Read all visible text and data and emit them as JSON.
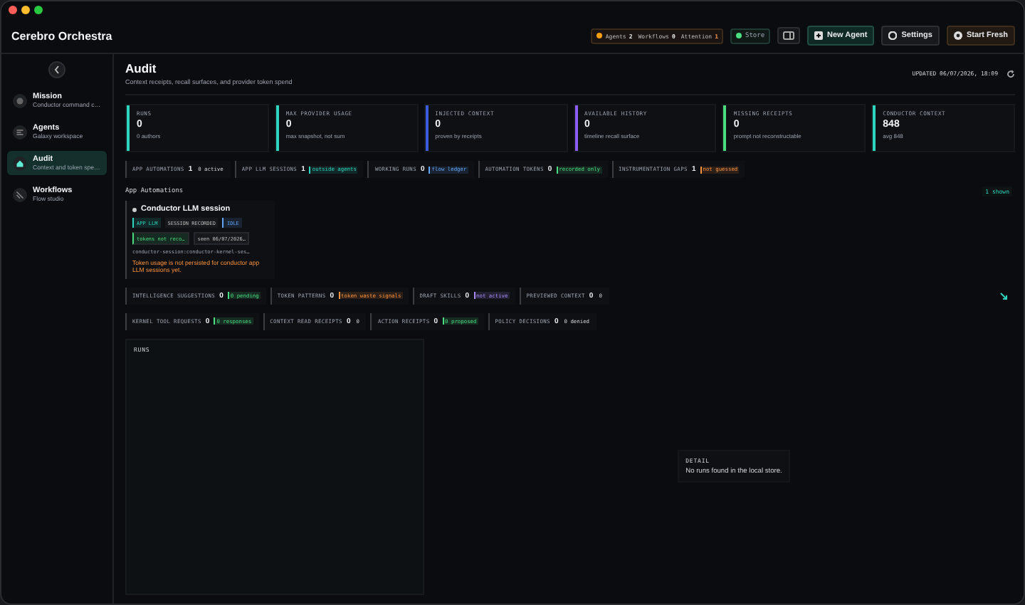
{
  "app": {
    "title": "Cerebro Orchestra"
  },
  "header": {
    "status": {
      "segments": [
        {
          "label": "Agents",
          "value": "2"
        },
        {
          "label": "Workflows",
          "value": "0"
        },
        {
          "label": "Attention",
          "value": "1"
        }
      ]
    },
    "store": {
      "label": "Store"
    },
    "buttons": [
      {
        "label": "New Agent",
        "kind": "primary"
      },
      {
        "label": "Settings",
        "kind": "plain"
      },
      {
        "label": "Start Fresh",
        "kind": "warn"
      }
    ]
  },
  "sidebar": {
    "items": [
      {
        "label": "Mission",
        "sub": "Conductor command c…",
        "selected": false
      },
      {
        "label": "Agents",
        "sub": "Galaxy workspace",
        "selected": false
      },
      {
        "label": "Audit",
        "sub": "Context and token spe…",
        "selected": true
      },
      {
        "label": "Workflows",
        "sub": "Flow studio",
        "selected": false
      }
    ]
  },
  "page": {
    "title": "Audit",
    "subtitle": "Context receipts, recall surfaces, and provider token spend",
    "updated": "UPDATED 06/07/2026, 18:09"
  },
  "stats": [
    {
      "label": "RUNS",
      "value": "0",
      "note": "0 authors",
      "color": "#2dd4bf"
    },
    {
      "label": "MAX PROVIDER USAGE",
      "value": "0",
      "note": "max snapshot, not sum",
      "color": "#2dd4bf"
    },
    {
      "label": "INJECTED CONTEXT",
      "value": "0",
      "note": "proven by receipts",
      "color": "#3b5bdb"
    },
    {
      "label": "AVAILABLE HISTORY",
      "value": "0",
      "note": "timeline recall surface",
      "color": "#8b5cf6"
    },
    {
      "label": "MISSING RECEIPTS",
      "value": "0",
      "note": "prompt not reconstructable",
      "color": "#4ade80"
    },
    {
      "label": "CONDUCTOR CONTEXT",
      "value": "848",
      "note": "avg 848",
      "color": "#2dd4bf"
    }
  ],
  "chip_rows": [
    [
      {
        "label": "APP AUTOMATIONS",
        "value": "1",
        "note": "0 active"
      },
      {
        "label": "APP LLM SESSIONS",
        "value": "1",
        "note": "outside agents",
        "color": "#2dd4bf"
      },
      {
        "label": "WORKING RUNS",
        "value": "0",
        "note": "flow ledger",
        "color": "#60a5fa"
      },
      {
        "label": "AUTOMATION TOKENS",
        "value": "0",
        "note": "recorded only",
        "color": "#4ade80"
      },
      {
        "label": "INSTRUMENTATION GAPS",
        "value": "1",
        "note": "not guessed",
        "color": "#fb923c"
      }
    ]
  ],
  "automations": {
    "title": "App Automations",
    "count": "1 shown",
    "cards": [
      {
        "title": "Conductor LLM session",
        "tags": [
          {
            "label": "APP LLM",
            "color": "#2dd4bf"
          },
          {
            "label": "SESSION RECORDED"
          },
          {
            "label": "IDLE",
            "color": "#60a5fa"
          }
        ],
        "meta": [
          {
            "label": "tokens not reco…",
            "color": "#4ade80"
          },
          {
            "label": "seen 06/07/2026…"
          }
        ],
        "id": "conductor-session:conductor-kernel-ses…",
        "warning": "Token usage is not persisted for conductor app LLM sessions yet."
      }
    ]
  },
  "chip_rows_2": [
    [
      {
        "label": "INTELLIGENCE SUGGESTIONS",
        "value": "0",
        "note": "0 pending",
        "color": "#4ade80"
      },
      {
        "label": "TOKEN PATTERNS",
        "value": "0",
        "note": "token waste signals",
        "color": "#fb923c"
      },
      {
        "label": "DRAFT SKILLS",
        "value": "0",
        "note": "not active",
        "color": "#a78bfa"
      },
      {
        "label": "PREVIEWED CONTEXT",
        "value": "0",
        "note": "0"
      }
    ],
    [
      {
        "label": "KERNEL TOOL REQUESTS",
        "value": "0",
        "note": "0 responses",
        "color": "#4ade80"
      },
      {
        "label": "CONTEXT READ RECEIPTS",
        "value": "0",
        "note": "0"
      },
      {
        "label": "ACTION RECEIPTS",
        "value": "0",
        "note": "0 proposed",
        "color": "#4ade80"
      },
      {
        "label": "POLICY DECISIONS",
        "value": "0",
        "note": "0 denied"
      }
    ]
  ],
  "runs": {
    "title": "RUNS"
  },
  "detail": {
    "title": "DETAIL",
    "message": "No runs found in the local store."
  }
}
